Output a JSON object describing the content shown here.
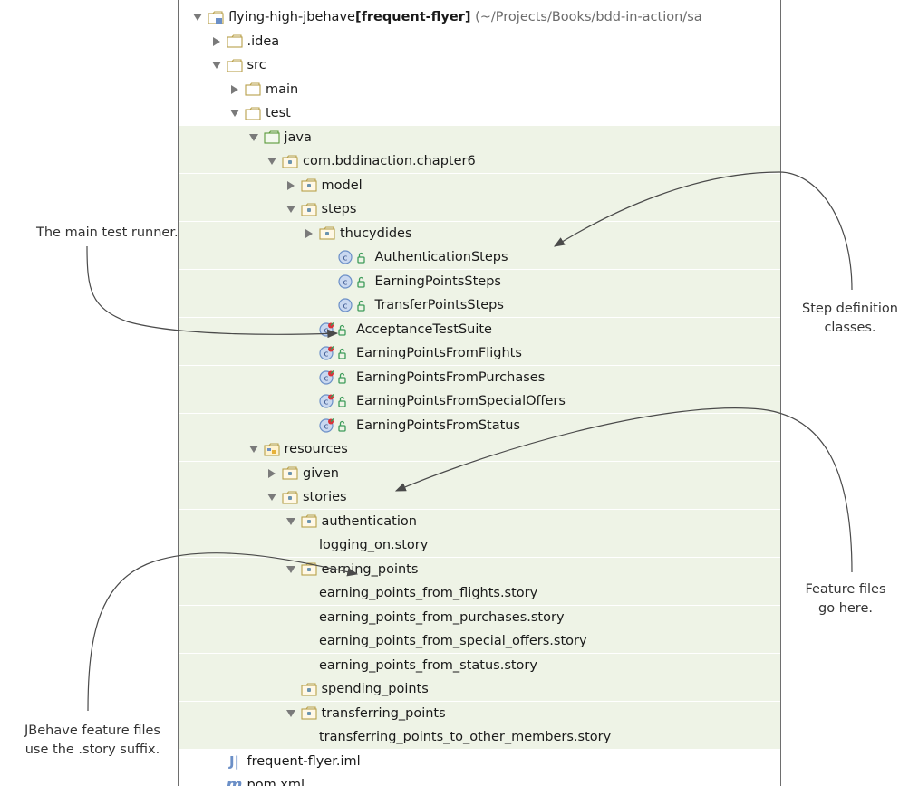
{
  "project": {
    "name": "flying-high-jbehave",
    "module": "[frequent-flyer]",
    "path": "(~/Projects/Books/bdd-in-action/sa"
  },
  "colors": {
    "folder": "#b9a04a",
    "java_folder": "#5a9a3a",
    "package_folder": "#6a93b0",
    "class_badge": "#6b8fc7",
    "runner_dot": "#d8343a",
    "access_icon": "#3d9c5a",
    "highlight_bg": "#eef3e6",
    "arrow": "#4a4a4a"
  },
  "tree": [
    {
      "label": "flying-high-jbehave",
      "label_bold": "[frequent-flyer]",
      "label_dim": "(~/Projects/Books/bdd-in-action/sa",
      "level": 0,
      "toggle": "expanded",
      "icon": "module-folder-icon",
      "highlight": false
    },
    {
      "label": ".idea",
      "level": 1,
      "toggle": "collapsed",
      "icon": "folder-icon",
      "highlight": false
    },
    {
      "label": "src",
      "level": 1,
      "toggle": "expanded",
      "icon": "folder-icon",
      "highlight": false
    },
    {
      "label": "main",
      "level": 2,
      "toggle": "collapsed",
      "icon": "folder-icon",
      "highlight": false
    },
    {
      "label": "test",
      "level": 2,
      "toggle": "expanded",
      "icon": "folder-icon",
      "highlight": false
    },
    {
      "label": "java",
      "level": 3,
      "toggle": "expanded",
      "icon": "java-folder-icon",
      "highlight": true
    },
    {
      "label": "com.bddinaction.chapter6",
      "level": 4,
      "toggle": "expanded",
      "icon": "package-icon",
      "highlight": true
    },
    {
      "label": "model",
      "level": 5,
      "toggle": "collapsed",
      "icon": "package-icon",
      "highlight": true
    },
    {
      "label": "steps",
      "level": 5,
      "toggle": "expanded",
      "icon": "package-icon",
      "highlight": true
    },
    {
      "label": "thucydides",
      "level": 6,
      "toggle": "collapsed",
      "icon": "package-icon",
      "highlight": true
    },
    {
      "label": "AuthenticationSteps",
      "level": 7,
      "toggle": "none",
      "icon": "class-icon",
      "highlight": true
    },
    {
      "label": "EarningPointsSteps",
      "level": 7,
      "toggle": "none",
      "icon": "class-icon",
      "highlight": true
    },
    {
      "label": "TransferPointsSteps",
      "level": 7,
      "toggle": "none",
      "icon": "class-icon",
      "highlight": true
    },
    {
      "label": "AcceptanceTestSuite",
      "level": 6,
      "toggle": "none",
      "icon": "test-class-icon",
      "highlight": true
    },
    {
      "label": "EarningPointsFromFlights",
      "level": 6,
      "toggle": "none",
      "icon": "test-class-icon",
      "highlight": true
    },
    {
      "label": "EarningPointsFromPurchases",
      "level": 6,
      "toggle": "none",
      "icon": "test-class-icon",
      "highlight": true
    },
    {
      "label": "EarningPointsFromSpecialOffers",
      "level": 6,
      "toggle": "none",
      "icon": "test-class-icon",
      "highlight": true
    },
    {
      "label": "EarningPointsFromStatus",
      "level": 6,
      "toggle": "none",
      "icon": "test-class-icon",
      "highlight": true
    },
    {
      "label": "resources",
      "level": 3,
      "toggle": "expanded",
      "icon": "resources-folder-icon",
      "highlight": true
    },
    {
      "label": "given",
      "level": 4,
      "toggle": "collapsed",
      "icon": "package-icon",
      "highlight": true
    },
    {
      "label": "stories",
      "level": 4,
      "toggle": "expanded",
      "icon": "package-icon",
      "highlight": true
    },
    {
      "label": "authentication",
      "level": 5,
      "toggle": "expanded",
      "icon": "package-icon",
      "highlight": true
    },
    {
      "label": "logging_on.story",
      "level": 6,
      "toggle": "none",
      "icon": "none",
      "highlight": true
    },
    {
      "label": "earning_points",
      "level": 5,
      "toggle": "expanded",
      "icon": "package-icon",
      "highlight": true
    },
    {
      "label": "earning_points_from_flights.story",
      "level": 6,
      "toggle": "none",
      "icon": "none",
      "highlight": true
    },
    {
      "label": "earning_points_from_purchases.story",
      "level": 6,
      "toggle": "none",
      "icon": "none",
      "highlight": true
    },
    {
      "label": "earning_points_from_special_offers.story",
      "level": 6,
      "toggle": "none",
      "icon": "none",
      "highlight": true
    },
    {
      "label": "earning_points_from_status.story",
      "level": 6,
      "toggle": "none",
      "icon": "none",
      "highlight": true
    },
    {
      "label": "spending_points",
      "level": 5,
      "toggle": "none",
      "icon": "package-icon",
      "highlight": true
    },
    {
      "label": "transferring_points",
      "level": 5,
      "toggle": "expanded",
      "icon": "package-icon",
      "highlight": true
    },
    {
      "label": "transferring_points_to_other_members.story",
      "level": 6,
      "toggle": "none",
      "icon": "none",
      "highlight": true
    },
    {
      "label": "frequent-flyer.iml",
      "level": 1,
      "toggle": "none",
      "icon": "iml-icon",
      "icon_text": "J|",
      "highlight": false
    },
    {
      "label": "pom.xml",
      "level": 1,
      "toggle": "none",
      "icon": "maven-icon",
      "icon_text": "m",
      "highlight": false
    }
  ],
  "annotations": [
    {
      "name": "main-test-runner-annotation",
      "lines": [
        "The main test runner."
      ]
    },
    {
      "name": "step-definition-annotation",
      "lines": [
        "Step definition",
        "classes."
      ]
    },
    {
      "name": "feature-files-annotation",
      "lines": [
        "Feature files",
        "go here."
      ]
    },
    {
      "name": "jbehave-suffix-annotation",
      "lines": [
        "JBehave feature files",
        "use the .story suffix."
      ]
    }
  ]
}
